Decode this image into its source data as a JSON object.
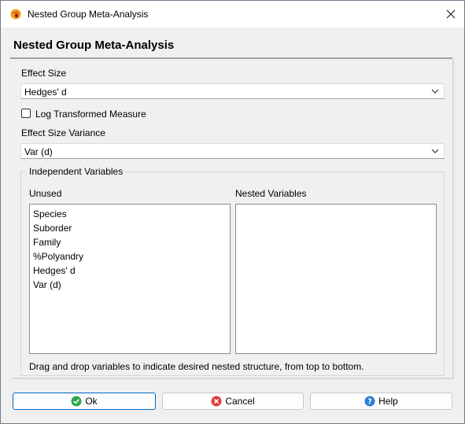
{
  "window": {
    "title": "Nested Group Meta-Analysis",
    "icon": "app-logo-icon",
    "close_icon": "close-icon"
  },
  "header": {
    "title": "Nested Group Meta-Analysis"
  },
  "effect_size": {
    "label": "Effect Size",
    "value": "Hedges' d",
    "log_transformed_label": "Log Transformed Measure",
    "log_transformed_checked": false
  },
  "variance": {
    "label": "Effect Size Variance",
    "value": "Var (d)"
  },
  "independent_variables": {
    "legend": "Independent Variables",
    "unused_label": "Unused",
    "nested_label": "Nested Variables",
    "unused_items": [
      "Species",
      "Suborder",
      "Family",
      "%Polyandry",
      "Hedges' d",
      "Var (d)"
    ],
    "nested_items": [],
    "hint": "Drag and drop variables to indicate desired nested structure, from top to bottom."
  },
  "buttons": {
    "ok": "Ok",
    "cancel": "Cancel",
    "help": "Help"
  },
  "colors": {
    "ok_icon": "#2aa84a",
    "cancel_icon": "#e03b3b",
    "help_icon": "#2b7fd6",
    "default_button_border": "#0067c0"
  }
}
